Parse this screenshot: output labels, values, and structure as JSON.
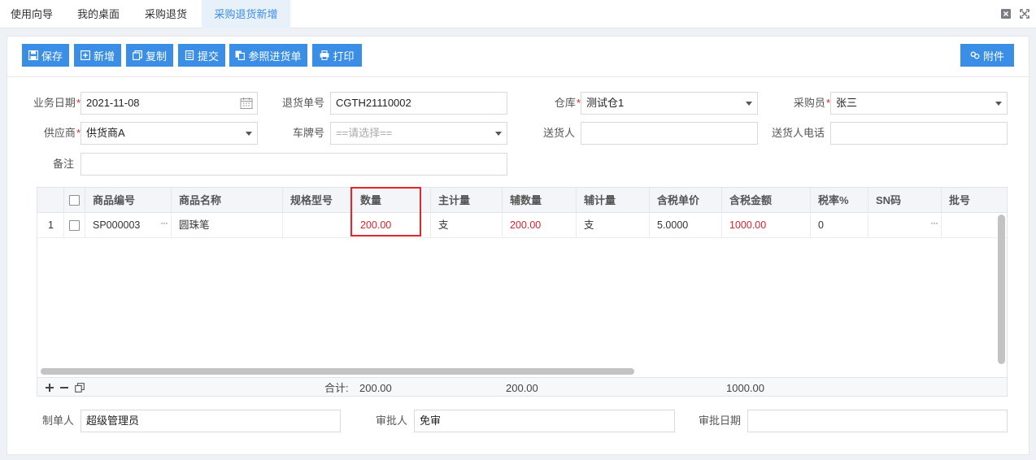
{
  "tabs": [
    {
      "label": "使用向导"
    },
    {
      "label": "我的桌面"
    },
    {
      "label": "采购退货"
    },
    {
      "label": "采购退货新增"
    }
  ],
  "toolbar": {
    "save": "保存",
    "add": "新增",
    "copy": "复制",
    "submit": "提交",
    "reference": "参照进货单",
    "print": "打印",
    "attachment": "附件"
  },
  "form": {
    "biz_date": {
      "label": "业务日期",
      "value": "2021-11-08"
    },
    "return_no": {
      "label": "退货单号",
      "value": "CGTH21110002"
    },
    "warehouse": {
      "label": "仓库",
      "value": "测试仓1"
    },
    "buyer": {
      "label": "采购员",
      "value": "张三"
    },
    "supplier": {
      "label": "供应商",
      "value": "供货商A"
    },
    "plate": {
      "label": "车牌号",
      "placeholder": "==请选择=="
    },
    "deliverer": {
      "label": "送货人",
      "value": ""
    },
    "deliverer_phone": {
      "label": "送货人电话",
      "value": ""
    },
    "remark": {
      "label": "备注",
      "value": ""
    },
    "required_mark": "*"
  },
  "grid": {
    "columns": [
      "商品编号",
      "商品名称",
      "规格型号",
      "数量",
      "主计量",
      "辅数量",
      "辅计量",
      "含税单价",
      "含税金额",
      "税率%",
      "SN码",
      "批号"
    ],
    "rows": [
      {
        "index": "1",
        "code": "SP000003",
        "name": "圆珠笔",
        "spec": "",
        "qty": "200.00",
        "unit": "支",
        "aux_qty": "200.00",
        "aux_unit": "支",
        "price": "5.0000",
        "amount": "1000.00",
        "tax": "0",
        "sn": "",
        "batch": ""
      }
    ],
    "footer": {
      "total_label": "合计:",
      "qty": "200.00",
      "aux_qty": "200.00",
      "amount": "1000.00"
    },
    "ellipsis": "···"
  },
  "bottom": {
    "maker": {
      "label": "制单人",
      "value": "超级管理员"
    },
    "approver": {
      "label": "审批人",
      "value": "免审"
    },
    "approve_date": {
      "label": "审批日期",
      "value": ""
    }
  },
  "colors": {
    "accent": "#3a8ee6",
    "required": "#e02020",
    "highlight": "#e3262b",
    "negative": "#d9232d"
  }
}
